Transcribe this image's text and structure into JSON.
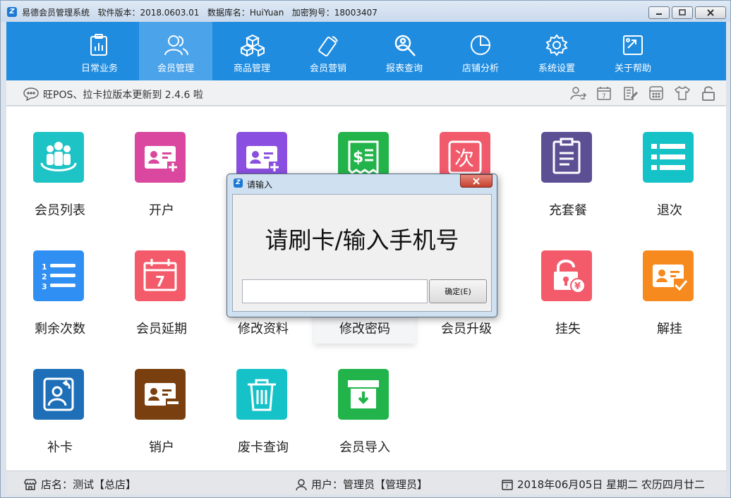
{
  "titlebar": {
    "title": "易德会员管理系统   软件版本：2018.0603.01   数据库名：HuiYuan   加密狗号：18003407"
  },
  "nav": {
    "items": [
      {
        "label": "日常业务"
      },
      {
        "label": "会员管理"
      },
      {
        "label": "商品管理"
      },
      {
        "label": "会员营销"
      },
      {
        "label": "报表查询"
      },
      {
        "label": "店铺分析"
      },
      {
        "label": "系统设置"
      },
      {
        "label": "关于帮助"
      }
    ],
    "active": "会员管理"
  },
  "notice": {
    "text": "旺POS、拉卡拉版本更新到 2.4.6 啦"
  },
  "tiles": [
    {
      "label": "会员列表",
      "color": "#1ec3c6",
      "icon": "members-group-icon"
    },
    {
      "label": "开户",
      "color": "#d9489e",
      "icon": "id-card-add-icon"
    },
    {
      "label": "",
      "color": "#8a4fe0",
      "icon": "id-card-add-icon"
    },
    {
      "label": "",
      "color": "#22b44a",
      "icon": "dollar-receipt-icon"
    },
    {
      "label": "",
      "color": "#f05a6b",
      "icon": "times-char-icon"
    },
    {
      "label": "充套餐",
      "color": "#5d4f94",
      "icon": "clipboard-icon"
    },
    {
      "label": "退次",
      "color": "#14c2c8",
      "icon": "list-icon"
    },
    {
      "label": "剩余次数",
      "color": "#2f8ff2",
      "icon": "numbered-list-icon"
    },
    {
      "label": "会员延期",
      "color": "#f35a6a",
      "icon": "calendar-icon"
    },
    {
      "label": "修改资料",
      "color": "#8a4fe0",
      "icon": "edit-profile-icon"
    },
    {
      "label": "修改密码",
      "color": "#2f8ff2",
      "icon": "key-icon"
    },
    {
      "label": "会员升级",
      "color": "#22b44a",
      "icon": "upgrade-icon"
    },
    {
      "label": "挂失",
      "color": "#f35a6a",
      "icon": "lock-yen-icon"
    },
    {
      "label": "解挂",
      "color": "#f68a1e",
      "icon": "id-card-check-icon"
    },
    {
      "label": "补卡",
      "color": "#1e6fb8",
      "icon": "reissue-card-icon"
    },
    {
      "label": "销户",
      "color": "#7a3f0e",
      "icon": "id-card-minus-icon"
    },
    {
      "label": "废卡查询",
      "color": "#14c2c8",
      "icon": "trash-icon"
    },
    {
      "label": "会员导入",
      "color": "#22b44a",
      "icon": "import-box-icon"
    }
  ],
  "status": {
    "store": "店名：测试【总店】",
    "user": "用户：管理员【管理员】",
    "date": "2018年06月05日 星期二 农历四月廿二"
  },
  "dialog": {
    "title": "请输入",
    "prompt": "请刷卡/输入手机号",
    "input_value": "",
    "ok_label": "确定(E)"
  }
}
